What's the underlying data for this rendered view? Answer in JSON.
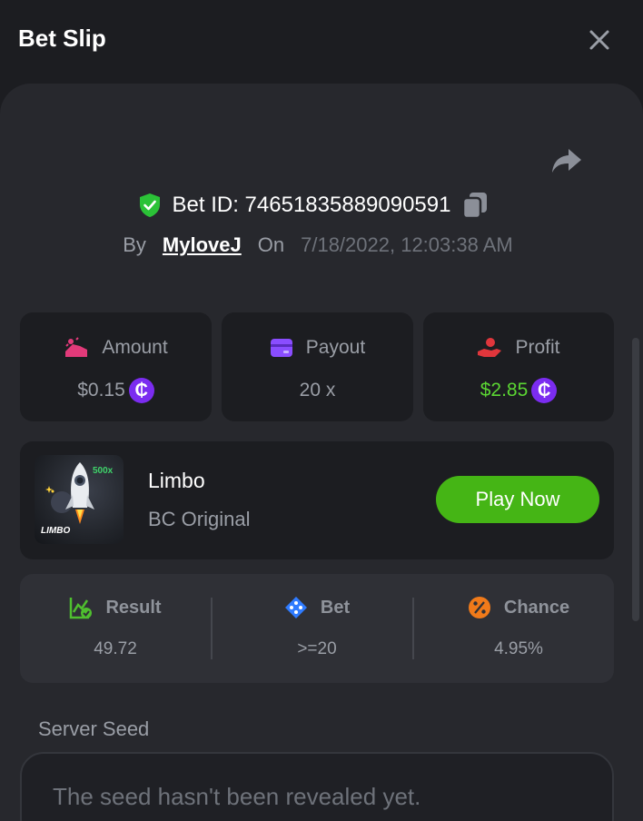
{
  "header": {
    "title": "Bet Slip"
  },
  "bet": {
    "id_text": "Bet ID: 74651835889090591",
    "by_label": "By",
    "username": "MyloveJ",
    "on_label": "On",
    "date": "7/18/2022, 12:03:38 AM"
  },
  "stats": {
    "amount": {
      "label": "Amount",
      "value": "$0.15"
    },
    "payout": {
      "label": "Payout",
      "value": "20 x"
    },
    "profit": {
      "label": "Profit",
      "value": "$2.85"
    }
  },
  "coin_symbol": "₵",
  "game": {
    "name": "Limbo",
    "subtitle": "BC Original",
    "thumb_multiplier": "500x",
    "thumb_logo": "LIMBO",
    "play_label": "Play Now"
  },
  "result": {
    "result": {
      "label": "Result",
      "value": "49.72"
    },
    "bet": {
      "label": "Bet",
      "value": ">=20"
    },
    "chance": {
      "label": "Chance",
      "value": "4.95%"
    }
  },
  "seed": {
    "label": "Server Seed",
    "text": "The seed hasn't been revealed yet."
  },
  "icons": {
    "close": "close-icon",
    "share": "share-icon",
    "shield": "shield-check-icon",
    "copy": "copy-icon",
    "amount": "coins-hand-icon",
    "payout": "wallet-card-icon",
    "profit": "hand-money-icon",
    "coin": "coin-icon",
    "result": "chart-check-icon",
    "bet": "dice-diamond-icon",
    "chance": "percent-icon"
  },
  "colors": {
    "accent_green": "#45b515",
    "profit_green": "#5bd633",
    "coin_purple": "#7b2cf0",
    "amount_pink": "#e23a7a",
    "payout_purple": "#8a4dff",
    "profit_red": "#e0363c",
    "bet_blue": "#2f7bff",
    "chance_orange": "#f07a1a"
  }
}
